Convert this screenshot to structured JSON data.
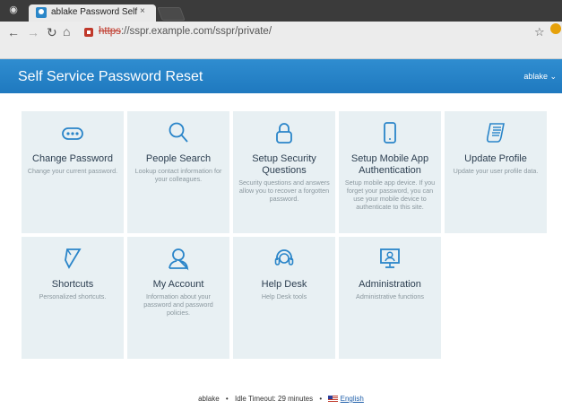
{
  "browser": {
    "tab_title": "ablake Password Self",
    "tab_close": "×",
    "url_https": "https",
    "url_rest": "://sspr.example.com/sspr/private/",
    "back_icon": "arrow-left-icon",
    "forward_icon": "arrow-right-icon",
    "reload_icon": "reload-icon",
    "home_icon": "home-icon",
    "star_icon": "star-icon"
  },
  "header": {
    "title": "Self Service Password Reset",
    "user": "ablake",
    "brand_color": "#2a85c9"
  },
  "tiles": [
    {
      "label": "Change Password",
      "desc": "Change your current password.",
      "icon": "password-dots-icon"
    },
    {
      "label": "People Search",
      "desc": "Lookup contact information for your colleagues.",
      "icon": "search-icon"
    },
    {
      "label": "Setup Security Questions",
      "desc": "Security questions and answers allow you to recover a forgotten password.",
      "icon": "lock-icon"
    },
    {
      "label": "Setup Mobile App Authentication",
      "desc": "Setup mobile app device. If you forget your password, you can use your mobile device to authenticate to this site.",
      "icon": "mobile-icon"
    },
    {
      "label": "Update Profile",
      "desc": "Update your user profile data.",
      "icon": "profile-icon"
    },
    {
      "label": "Shortcuts",
      "desc": "Personalized shortcuts.",
      "icon": "shortcut-icon"
    },
    {
      "label": "My Account",
      "desc": "Information about your password and password policies.",
      "icon": "user-icon"
    },
    {
      "label": "Help Desk",
      "desc": "Help Desk tools",
      "icon": "headset-icon"
    },
    {
      "label": "Administration",
      "desc": "Administrative functions",
      "icon": "admin-monitor-icon"
    }
  ],
  "footer": {
    "user": "ablake",
    "idle": "Idle Timeout: 29 minutes",
    "language": "English"
  }
}
